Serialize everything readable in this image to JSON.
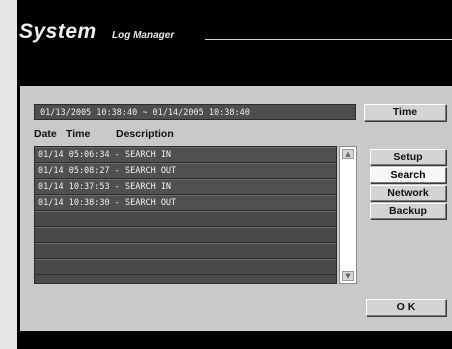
{
  "title": {
    "main": "System",
    "sub": "Log Manager"
  },
  "range": {
    "text": "01/13/2005  10:38:40 ~ 01/14/2005  10:38:40"
  },
  "buttons": {
    "time": "Time",
    "setup": "Setup",
    "search": "Search",
    "network": "Network",
    "backup": "Backup",
    "ok": "O K"
  },
  "columns": {
    "date": "Date",
    "time": "Time",
    "description": "Description"
  },
  "log": {
    "rows": [
      "01/14 05:06:34 - SEARCH IN",
      "01/14 05:08:27 - SEARCH OUT",
      "01/14 10:37:53 - SEARCH IN",
      "01/14 10:38:30 - SEARCH OUT",
      "",
      "",
      "",
      ""
    ]
  },
  "scrollbar": {
    "up": "▲",
    "down": "▼"
  },
  "colors": {
    "panel": "#c9c9c9",
    "list_bg": "#4b4b4b",
    "active_button": "#f7f7f7"
  }
}
